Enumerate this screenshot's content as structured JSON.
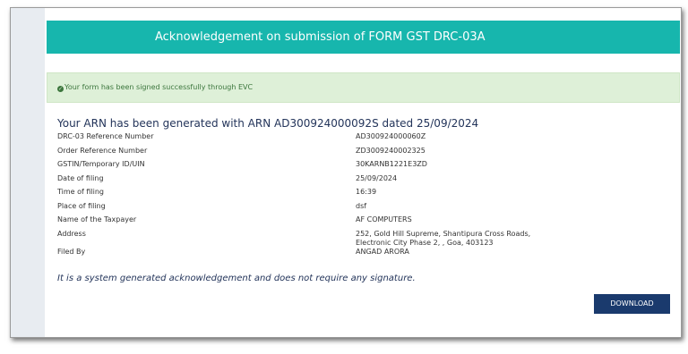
{
  "header": {
    "title": "Acknowledgement on submission of FORM GST DRC-03A"
  },
  "alert": {
    "icon": "check-circle-icon",
    "message": "Your form has been signed successfully through EVC"
  },
  "arn_title": "Your ARN has been generated with ARN AD300924000092S dated 25/09/2024",
  "details": [
    {
      "label": "DRC-03 Reference Number",
      "value": "AD300924000060Z"
    },
    {
      "label": "Order Reference Number",
      "value": "ZD3009240002325"
    },
    {
      "label": "GSTIN/Temporary ID/UIN",
      "value": "30KARNB1221E3ZD"
    },
    {
      "label": "Date of filing",
      "value": "25/09/2024"
    },
    {
      "label": "Time of filing",
      "value": "16:39"
    },
    {
      "label": "Place of filing",
      "value": "dsf"
    },
    {
      "label": "Name of the Taxpayer",
      "value": "AF COMPUTERS"
    },
    {
      "label": "Address",
      "value": "252, Gold Hill Supreme, Shantipura Cross Roads, Electronic City Phase 2, , Goa, 403123"
    },
    {
      "label": "Filed By",
      "value": "ANGAD ARORA"
    }
  ],
  "note": "It is a system generated acknowledgement and does not require any signature.",
  "download_label": "DOWNLOAD",
  "colors": {
    "header_bg": "#17b6ad",
    "success_bg": "#def0d8",
    "success_text": "#3c763d",
    "title_text": "#23345a",
    "button_bg": "#1a3a6d"
  }
}
